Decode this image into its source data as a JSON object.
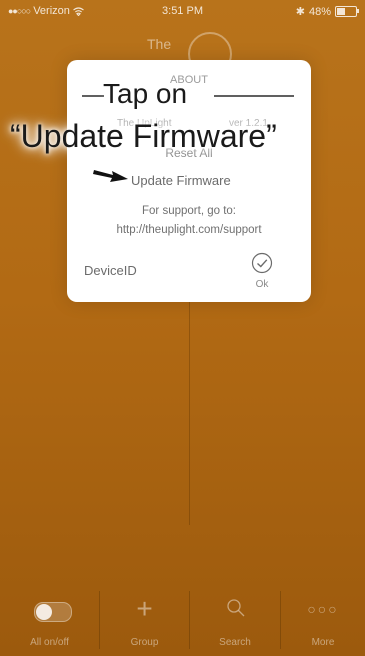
{
  "status_bar": {
    "carrier": "Verizon",
    "signal": "●●○○○",
    "time": "3:51 PM",
    "battery_percent": "48%",
    "battery_level": 0.48
  },
  "background": {
    "logo_text": "The"
  },
  "dialog": {
    "title": "ABOUT",
    "app_name": "The UpLight",
    "version": "ver 1.2.1",
    "reset_label": "Reset All",
    "update_firmware_label": "Update Firmware",
    "support_label": "For support, go to:",
    "support_url": "http://theuplight.com/support",
    "device_id_label": "DeviceID",
    "ok_label": "Ok"
  },
  "annotation": {
    "line1": "Tap on",
    "line2": "“Update Firmware”"
  },
  "tab_bar": {
    "items": [
      {
        "label": "All on/off",
        "icon": "toggle-icon"
      },
      {
        "label": "Group",
        "icon": "plus-icon"
      },
      {
        "label": "Search",
        "icon": "search-icon"
      },
      {
        "label": "More",
        "icon": "more-icon"
      }
    ]
  },
  "colors": {
    "background": "#b26a14",
    "dialog": "#ffffff"
  }
}
